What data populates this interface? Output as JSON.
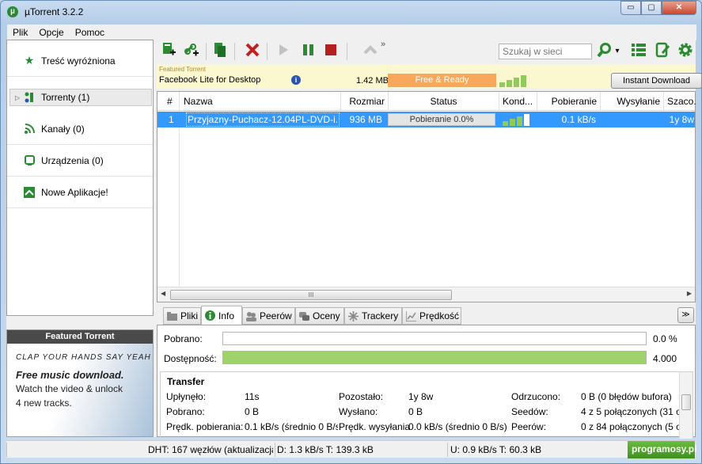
{
  "window": {
    "title": "µTorrent 3.2.2",
    "app_icon_glyph": "µ",
    "buttons": {
      "minimize": "▭",
      "maximize": "▢",
      "close": "✕"
    }
  },
  "menu": [
    "Plik",
    "Opcje",
    "Pomoc"
  ],
  "sidebar": {
    "items": [
      {
        "label": "Treść wyróżniona",
        "icon": "star-icon"
      },
      {
        "label": "Torrenty (1)",
        "icon": "torrents-icon",
        "expander": "▷"
      },
      {
        "label": "Kanały (0)",
        "icon": "rss-icon"
      },
      {
        "label": "Urządzenia (0)",
        "icon": "device-icon"
      },
      {
        "label": "Nowe Aplikacje!",
        "icon": "apps-icon"
      }
    ]
  },
  "featured": {
    "header": "Featured Torrent",
    "line1": "CLAP YOUR HANDS SAY YEAH",
    "line2": "Free music download.",
    "line3": "Watch the video & unlock",
    "line4": "4 new tracks."
  },
  "toolbar": {
    "search_placeholder": "Szukaj w sieci",
    "more": "»",
    "search_dropdown": "▾"
  },
  "ad": {
    "small_label": "Featured Torrent",
    "title": "Facebook Lite for Desktop",
    "info": "i",
    "size": "1.42 MB",
    "status": "Free & Ready",
    "button": "Instant Download"
  },
  "list": {
    "columns": [
      "#",
      "Nazwa",
      "Rozmiar",
      "Status",
      "Kond...",
      "Pobieranie",
      "Wysyłanie",
      "Szaco..."
    ],
    "rows": [
      {
        "num": "1",
        "name": "Przyjazny-Puchacz-12.04PL-DVD-i...",
        "size": "936 MB",
        "status": "Pobieranie 0.0%",
        "down": "0.1 kB/s",
        "up": "",
        "eta": "1y 8w"
      }
    ],
    "scroll_grip": "III",
    "scroll_left": "◀",
    "scroll_right": "▶"
  },
  "tabs": [
    {
      "label": "Pliki"
    },
    {
      "label": "Info",
      "active": true
    },
    {
      "label": "Peerów"
    },
    {
      "label": "Oceny"
    },
    {
      "label": "Trackery"
    },
    {
      "label": "Prędkość"
    }
  ],
  "collapse_glyph": "≫",
  "details": {
    "downloaded_label": "Pobrano:",
    "downloaded_value": "0.0 %",
    "downloaded_fraction": 0.0,
    "availability_label": "Dostępność:",
    "availability_value": "4.000",
    "availability_fraction": 1.0,
    "transfer_title": "Transfer",
    "rows": [
      [
        "Upłynęło:",
        "11s",
        "Pozostało:",
        "1y 8w",
        "Odrzucono:",
        "0 B (0 błędów bufora)"
      ],
      [
        "Pobrano:",
        "0 B",
        "Wysłano:",
        "0 B",
        "Seedów:",
        "4 z 5 połączonych (31 o"
      ],
      [
        "Prędk. pobierania:",
        "0.1 kB/s (średnio 0 B/s",
        "Prędk. wysyłania:",
        "0.0 kB/s (średnio 0 B/s)",
        "Peerów:",
        "0 z 84 połączonych (5 o"
      ]
    ]
  },
  "statusbar": {
    "dht": "DHT: 167 węzłów (aktualizacja",
    "down": "D: 1.3 kB/s T: 139.3 kB",
    "up": "U: 0.9 kB/s T: 60.3 kB",
    "watermark": "programosy.pl"
  },
  "colors": {
    "selection": "#3399ff",
    "progress_green": "#9fd26a",
    "ad_orange": "#f7a85a"
  }
}
